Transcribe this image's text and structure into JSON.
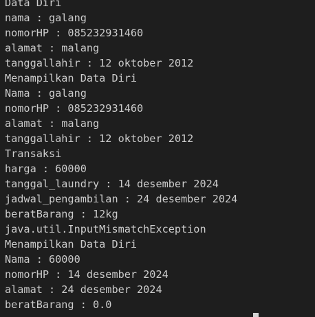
{
  "terminal": {
    "lines": [
      "Data Diri",
      "nama : galang",
      "nomorHP : 085232931460",
      "alamat : malang",
      "tanggallahir : 12 oktober 2012",
      "Menampilkan Data Diri",
      "Nama : galang",
      "nomorHP : 085232931460",
      "alamat : malang",
      "tanggallahir : 12 oktober 2012",
      "Transaksi",
      "harga : 60000",
      "tanggal_laundry : 14 desember 2024",
      "jadwal_pengambilan : 24 desember 2024",
      "beratBarang : 12kg",
      "java.util.InputMismatchException",
      "Menampilkan Data Diri",
      "Nama : 60000",
      "nomorHP : 14 desember 2024",
      "alamat : 24 desember 2024",
      "beratBarang : 0.0"
    ],
    "cursor_icon": "block-cursor-icon"
  }
}
